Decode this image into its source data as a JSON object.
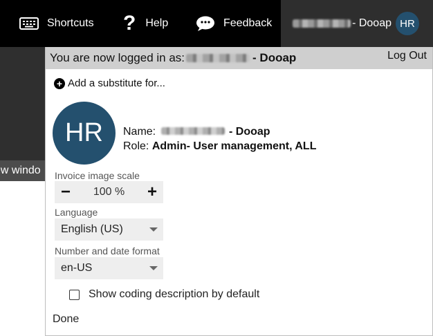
{
  "topbar": {
    "shortcuts_label": "Shortcuts",
    "help_label": "Help",
    "feedback_label": "Feedback",
    "user_suffix": "- Dooap",
    "user_initials": "HR",
    "icons": {
      "shortcuts": "keyboard-icon",
      "help": "question-mark-icon",
      "feedback": "chat-bubble-icon"
    }
  },
  "background": {
    "partial_text": "ew windo"
  },
  "panel": {
    "logged_in_prefix": "You are now logged in as:",
    "logged_in_suffix": "- Dooap",
    "logout_label": "Log Out",
    "add_substitute_label": "Add a substitute for...",
    "avatar_initials": "HR",
    "name_label": "Name:",
    "name_suffix": "- Dooap",
    "role_label": "Role:",
    "role_value": "Admin- User management, ALL",
    "invoice_scale": {
      "label": "Invoice image scale",
      "value": "100 %",
      "minus": "−",
      "plus": "+"
    },
    "language": {
      "label": "Language",
      "value": "English (US)"
    },
    "format": {
      "label": "Number and date format",
      "value": "en-US"
    },
    "coding_checkbox": {
      "label": "Show coding description by default",
      "checked": false
    },
    "done_label": "Done"
  },
  "colors": {
    "topbar_bg": "#000000",
    "user_tab_bg": "#2e2e2e",
    "avatar_bg": "#24506e",
    "header_bg": "#cfcfcf",
    "control_bg": "#eeeeee"
  }
}
